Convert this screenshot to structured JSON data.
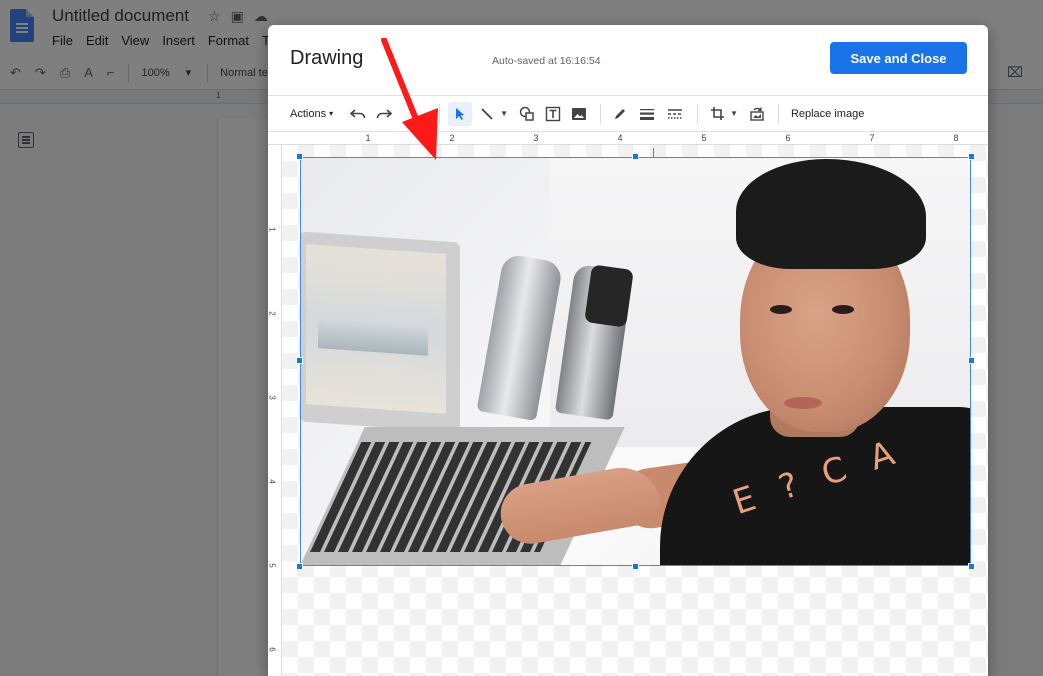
{
  "docs": {
    "title": "Untitled document",
    "menu": [
      "File",
      "Edit",
      "View",
      "Insert",
      "Format",
      "T"
    ],
    "zoom": "100%",
    "style": "Normal te",
    "ruler_mark": "1"
  },
  "dialog": {
    "title": "Drawing",
    "autosave": "Auto-saved at 16:16:54",
    "save_label": "Save and Close",
    "actions_label": "Actions",
    "replace_label": "Replace image"
  },
  "ruler": {
    "h_numbers": [
      "1",
      "2",
      "3",
      "4",
      "5",
      "6",
      "7",
      "8"
    ],
    "v_numbers": [
      "1",
      "2",
      "3",
      "4",
      "5",
      "6"
    ]
  },
  "image_overlay_text": "E ? C A",
  "colors": {
    "accent": "#1a73e8",
    "selection": "#4285f4",
    "arrow": "#ff1a1a"
  },
  "icons": {
    "undo": "undo-icon",
    "redo": "redo-icon",
    "select": "cursor-icon",
    "line": "line-icon",
    "shape": "shape-icon",
    "textbox": "textbox-icon",
    "image": "image-icon",
    "pen": "pen-icon",
    "line_weight": "line-weight-icon",
    "line_dash": "line-dash-icon",
    "crop": "crop-icon",
    "reset_image": "reset-image-icon"
  }
}
